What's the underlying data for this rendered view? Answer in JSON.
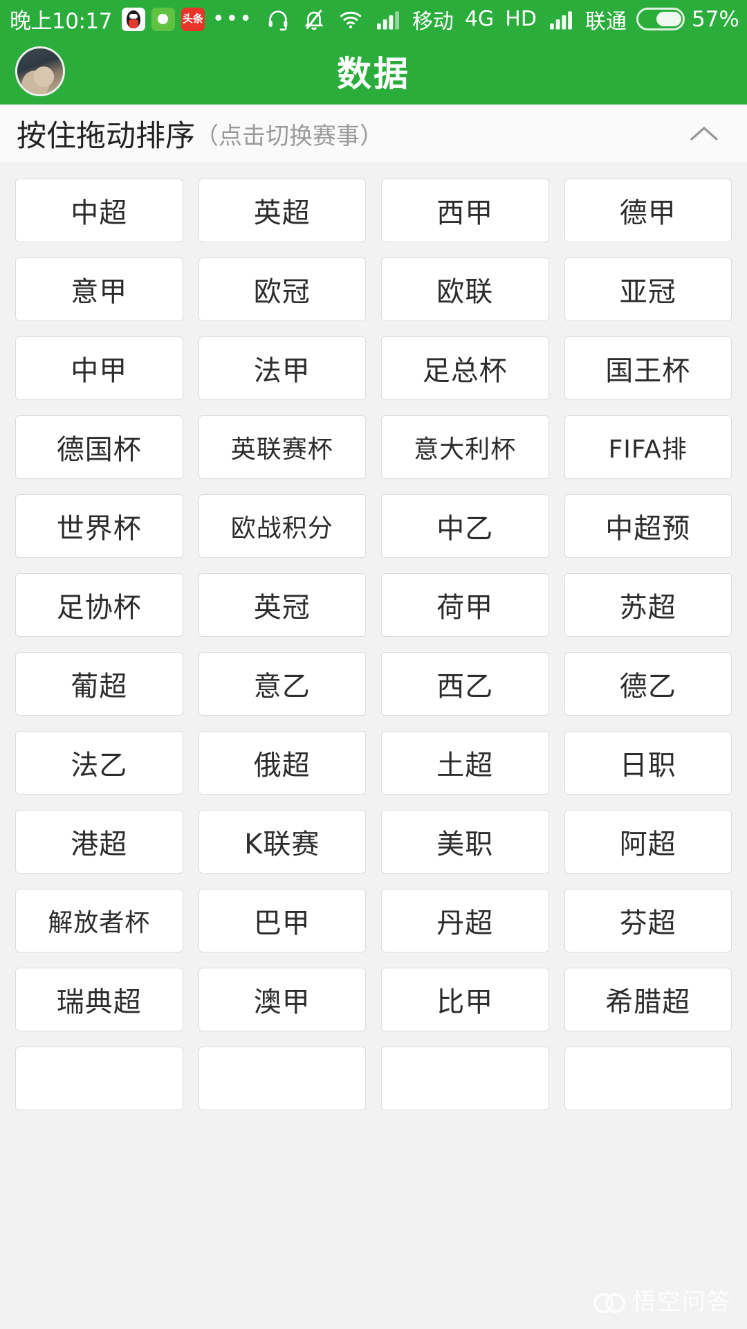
{
  "status_bar": {
    "time": "晚上10:17",
    "app_icons": [
      "qq-icon",
      "soccer-app-icon",
      "toutiao-icon"
    ],
    "more_dots": "•••",
    "icons": [
      "headset-icon",
      "bell-muted-icon",
      "wifi-icon",
      "signal-icon"
    ],
    "carrier_1": "移动",
    "network_type": "4G",
    "hd_label": "HD",
    "carrier_2": "联通",
    "battery_percent": "57%",
    "bg_color": "#2aad3b"
  },
  "title_bar": {
    "title": "数据",
    "avatar": "user-avatar",
    "bg_color": "#2aad3b"
  },
  "section_header": {
    "main_text": "按住拖动排序",
    "sub_text": "（点击切换赛事）",
    "collapse_icon": "chevron-up-icon"
  },
  "grid": {
    "columns": 4,
    "tiles": [
      "中超",
      "英超",
      "西甲",
      "德甲",
      "意甲",
      "欧冠",
      "欧联",
      "亚冠",
      "中甲",
      "法甲",
      "足总杯",
      "国王杯",
      "德国杯",
      "英联赛杯",
      "意大利杯",
      "FIFA排",
      "世界杯",
      "欧战积分",
      "中乙",
      "中超预",
      "足协杯",
      "英冠",
      "荷甲",
      "苏超",
      "葡超",
      "意乙",
      "西乙",
      "德乙",
      "法乙",
      "俄超",
      "土超",
      "日职",
      "港超",
      "K联赛",
      "美职",
      "阿超",
      "解放者杯",
      "巴甲",
      "丹超",
      "芬超",
      "瑞典超",
      "澳甲",
      "比甲",
      "希腊超",
      "",
      "",
      "",
      ""
    ]
  },
  "watermark": {
    "text": "悟空问答",
    "logo": "wukong-logo"
  }
}
